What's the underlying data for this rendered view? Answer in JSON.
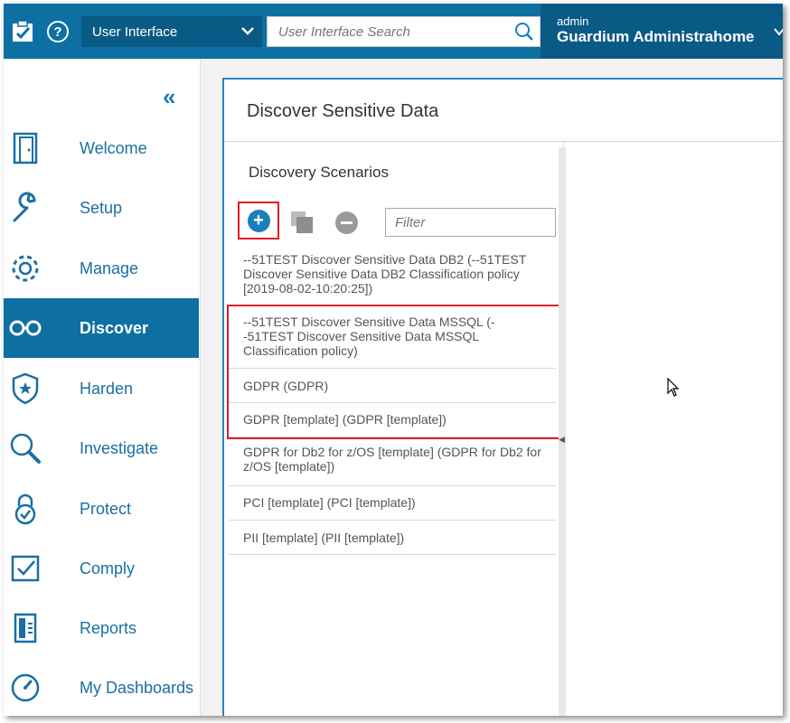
{
  "header": {
    "help_icon_label": "?",
    "ui_selector_value": "User Interface",
    "search_placeholder": "User Interface Search",
    "user_role": "admin",
    "user_name": "Guardium Administrahome"
  },
  "sidebar": {
    "collapse_label": "«",
    "items": [
      {
        "label": "Welcome",
        "icon": "door-icon"
      },
      {
        "label": "Setup",
        "icon": "wrench-icon"
      },
      {
        "label": "Manage",
        "icon": "gear-icon"
      },
      {
        "label": "Discover",
        "icon": "glasses-icon",
        "active": true
      },
      {
        "label": "Harden",
        "icon": "shield-star-icon"
      },
      {
        "label": "Investigate",
        "icon": "magnifier-icon"
      },
      {
        "label": "Protect",
        "icon": "lock-icon"
      },
      {
        "label": "Comply",
        "icon": "checklist-icon"
      },
      {
        "label": "Reports",
        "icon": "report-icon"
      },
      {
        "label": "My Dashboards",
        "icon": "dashboard-gauge-icon"
      }
    ]
  },
  "main": {
    "title": "Discover Sensitive Data",
    "scenarios_title": "Discovery Scenarios",
    "filter_placeholder": "Filter",
    "add_label": "+",
    "scenarios": [
      "--51TEST Discover Sensitive Data DB2 (--51TEST Discover Sensitive Data DB2 Classification policy [2019-08-02-10:20:25])",
      "--51TEST Discover Sensitive Data MSSQL (--51TEST Discover Sensitive Data MSSQL Classification policy)",
      "GDPR (GDPR)",
      "GDPR [template] (GDPR [template])",
      "GDPR for Db2 for z/OS [template] (GDPR for Db2 for z/OS [template])",
      "PCI [template] (PCI [template])",
      "PII [template] (PII [template])"
    ]
  },
  "colors": {
    "header_blue": "#0e6fa3",
    "header_dark": "#0a5a86",
    "highlight_red": "#e11b22",
    "link_blue": "#1a6fa3"
  }
}
